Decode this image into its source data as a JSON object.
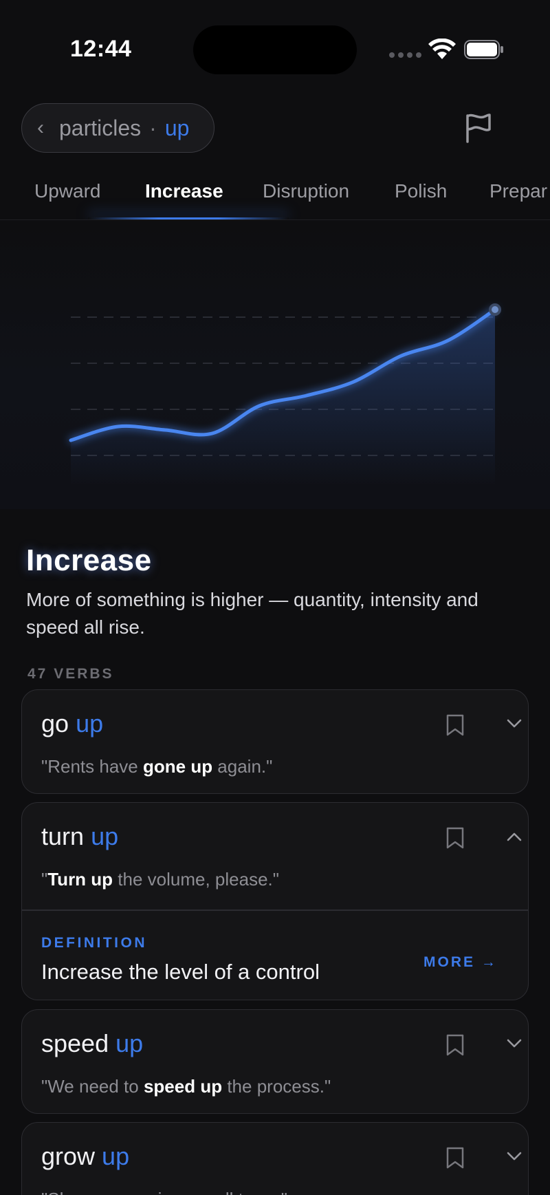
{
  "status_bar": {
    "time": "12:44"
  },
  "header": {
    "back_label": "particles",
    "separator": "·",
    "particle": "up"
  },
  "tabs": [
    {
      "label": "Upward",
      "active": false
    },
    {
      "label": "Increase",
      "active": true
    },
    {
      "label": "Disruption",
      "active": false
    },
    {
      "label": "Polish",
      "active": false
    },
    {
      "label": "Prepar",
      "active": false
    }
  ],
  "chart_data": {
    "type": "area",
    "title": "",
    "xlabel": "",
    "ylabel": "",
    "grid": true,
    "series": [
      {
        "values": [
          1.0,
          1.8,
          1.6,
          1.4,
          3.0,
          3.6,
          4.4,
          5.9,
          6.8,
          8.6
        ]
      }
    ],
    "color": "#4a86f0"
  },
  "section": {
    "title": "Increase",
    "description": "More of something is higher — quantity, intensity and speed all rise.",
    "count_label": "47 VERBS"
  },
  "cards": [
    {
      "verb": "go",
      "particle": "up",
      "example_before": "\"Rents have ",
      "example_bold": "gone up",
      "example_after": " again.\"",
      "expanded": false
    },
    {
      "verb": "turn",
      "particle": "up",
      "example_before": "\"",
      "example_bold": "Turn up",
      "example_after": " the volume, please.\"",
      "expanded": true,
      "definition_label": "DEFINITION",
      "definition": "Increase the level of a control",
      "more_label": "MORE →"
    },
    {
      "verb": "speed",
      "particle": "up",
      "example_before": "\"We need to ",
      "example_bold": "speed up",
      "example_after": " the process.\"",
      "expanded": false
    },
    {
      "verb": "grow",
      "particle": "up",
      "example_before": "\"She ",
      "example_bold": "grew up",
      "example_after": " in a small town.\"",
      "expanded": false
    }
  ],
  "colors": {
    "accent": "#3d7bea",
    "background": "#0e0e10",
    "card": "#151517"
  }
}
